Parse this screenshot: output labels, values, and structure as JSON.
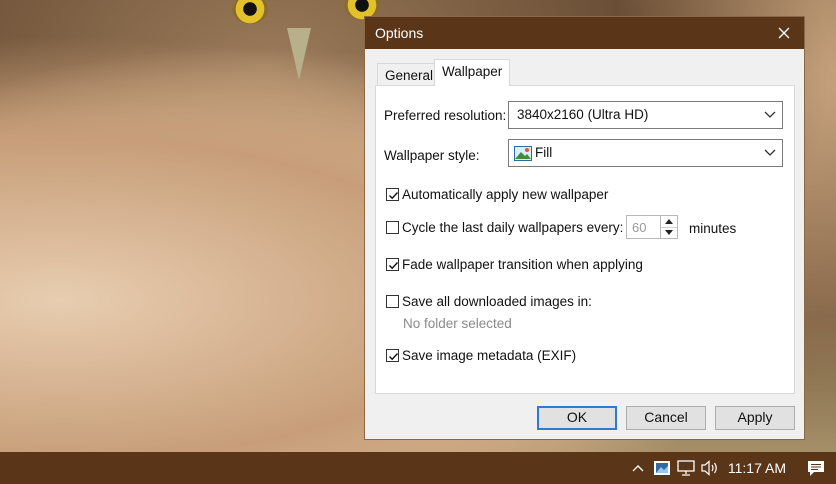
{
  "dialog": {
    "title": "Options",
    "tabs": [
      {
        "label": "General",
        "active": false
      },
      {
        "label": "Wallpaper",
        "active": true
      }
    ],
    "preferred_resolution": {
      "label": "Preferred resolution:",
      "value": "3840x2160 (Ultra HD)"
    },
    "wallpaper_style": {
      "label": "Wallpaper style:",
      "value": "Fill"
    },
    "options": [
      {
        "label": "Automatically apply new wallpaper",
        "checked": true
      },
      {
        "label": "Cycle the last daily wallpapers every:",
        "checked": false
      },
      {
        "label": "Fade wallpaper transition when applying",
        "checked": true
      },
      {
        "label": "Save all downloaded images in:",
        "checked": false
      },
      {
        "label": "Save image metadata (EXIF)",
        "checked": true
      }
    ],
    "cycle_value": "60",
    "cycle_unit": "minutes",
    "folder_status": "No folder selected",
    "buttons": {
      "ok": "OK",
      "cancel": "Cancel",
      "apply": "Apply"
    }
  },
  "taskbar": {
    "clock": "11:17 AM",
    "tray_icons": [
      "chevron-up-icon",
      "wallpaper-app-icon",
      "network-icon",
      "volume-icon",
      "notifications-icon"
    ]
  },
  "colors": {
    "titlebar": "#5a3518",
    "taskbar": "#5a3518",
    "accent": "#2d7bd1"
  }
}
